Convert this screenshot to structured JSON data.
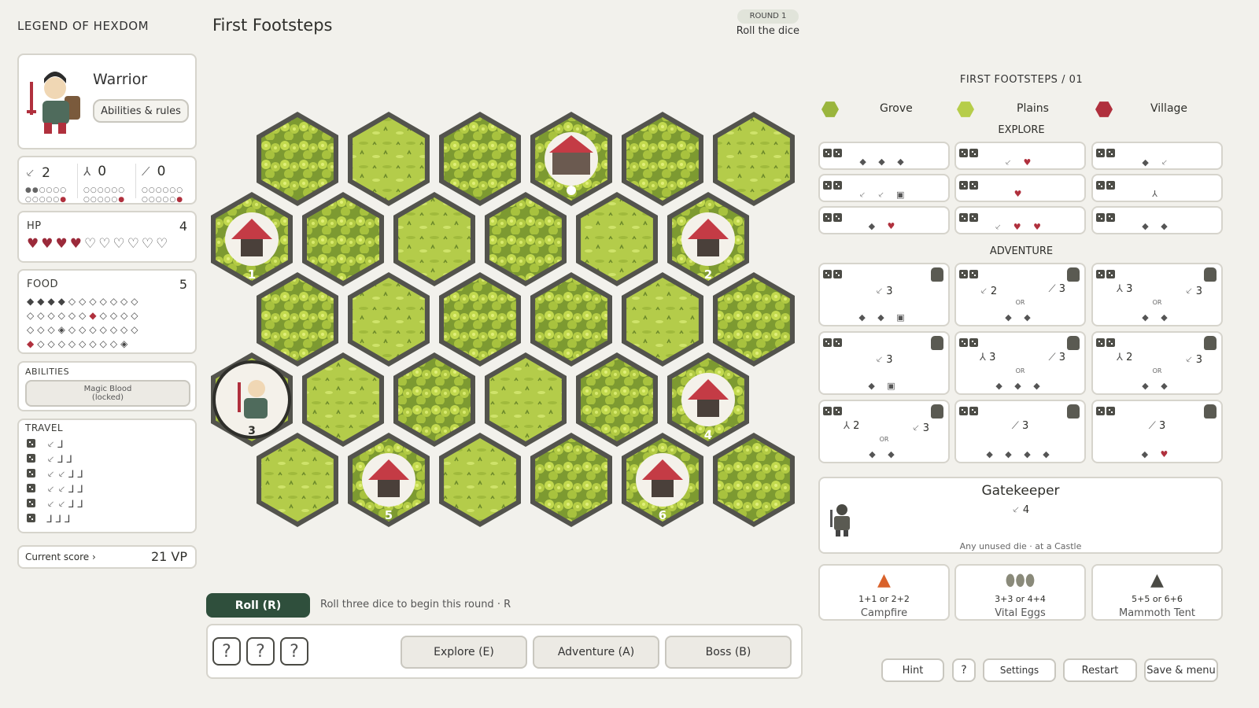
{
  "app": {
    "title": "LEGEND OF HEXDOM"
  },
  "level": {
    "title": "First Footsteps",
    "round_badge": "ROUND 1",
    "round_status": "Roll the dice"
  },
  "hero": {
    "class_name": "Warrior",
    "abilities_button": "Abilities & rules",
    "avatar_icon": "warrior-portrait"
  },
  "stats": [
    {
      "icon": "sword-icon",
      "value": "2"
    },
    {
      "icon": "boot-icon",
      "value": "0"
    },
    {
      "icon": "wand-icon",
      "value": "0"
    }
  ],
  "hp": {
    "label": "HP",
    "value": "4",
    "filled": 4,
    "total": 10
  },
  "food": {
    "label": "FOOD",
    "value": "5"
  },
  "abilities": {
    "label": "ABILITIES",
    "item_line1": "Magic Blood",
    "item_line2": "(locked)"
  },
  "travel": {
    "label": "TRAVEL"
  },
  "score": {
    "label": "Current score",
    "chevron": "›",
    "value": "21 VP"
  },
  "board": {
    "tile_numbers": [
      "1",
      "2",
      "3",
      "4",
      "5",
      "6"
    ],
    "terrain_colors": {
      "forest": "#8ea83a",
      "plains": "#b3c94c",
      "border": "#53534d"
    }
  },
  "roll": {
    "button": "Roll (R)",
    "hint": "Roll three dice to begin this round · R"
  },
  "dice_slots": [
    "?",
    "?",
    "?"
  ],
  "actions": {
    "explore": "Explore (E)",
    "adventure": "Adventure (A)",
    "boss": "Boss (B)"
  },
  "right": {
    "level_label": "FIRST FOOTSTEPS",
    "separator": "/",
    "level_number": "01",
    "terrains": [
      "Grove",
      "Plains",
      "Village"
    ],
    "explore_label": "EXPLORE",
    "adventure_label": "ADVENTURE",
    "adv_values": [
      "3",
      "2",
      "3",
      "3",
      "3",
      "3",
      "3",
      "3",
      "2",
      "3",
      "2",
      "3",
      "3",
      "3"
    ],
    "or_label": "OR"
  },
  "boss": {
    "name": "Gatekeeper",
    "value": "4",
    "note": "Any unused die · at a Castle"
  },
  "rewards": [
    {
      "combo": "1+1 or 2+2",
      "name": "Campfire"
    },
    {
      "combo": "3+3 or 4+4",
      "name": "Vital Eggs"
    },
    {
      "combo": "5+5 or 6+6",
      "name": "Mammoth Tent"
    }
  ],
  "footer": {
    "hint": "Hint",
    "help": "?",
    "settings": "Settings",
    "restart": "Restart",
    "save": "Save & menu"
  },
  "colors": {
    "accent": "#2f4f3c",
    "heart": "#9b2a3a",
    "grove": "#8ea83a",
    "village_roof": "#c43b45"
  }
}
